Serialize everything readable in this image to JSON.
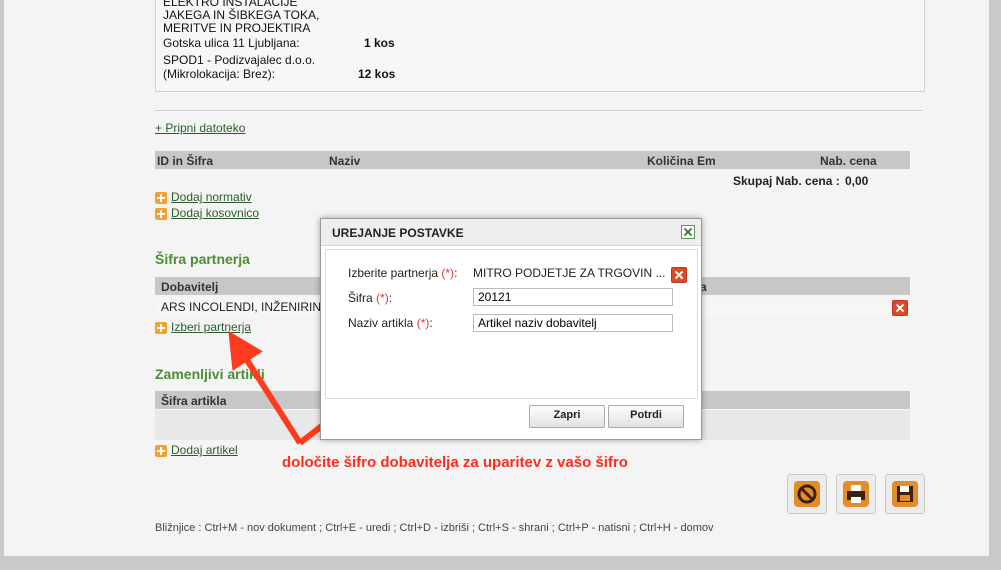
{
  "top_box": {
    "lines": [
      "ELEKTRO INSTALACIJE",
      "JAKEGA IN ŠIBKEGA TOKA,",
      "MERITVE IN PROJEKTIRA",
      "Gotska ulica 11 Ljubljana:",
      "SPOD1 - Podizvajalec d.o.o.",
      "(Mikrolokacija: Brez):"
    ],
    "qty1": "1 kos",
    "qty2": "12 kos"
  },
  "attach_link": "+ Pripni datoteko",
  "items_table": {
    "headers": [
      "ID in Šifra",
      "Naziv",
      "Količina Em",
      "Nab. cena"
    ],
    "total_label": "Skupaj Nab. cena :",
    "total_value": "0,00",
    "add_normative": "Dodaj normativ",
    "add_piece": "Dodaj kosovnico"
  },
  "partner_section": {
    "title": "Šifra partnerja",
    "header_supplier": "Dobavitelj",
    "header_right": "a",
    "row_supplier": "ARS INCOLENDI, INŽENIRING",
    "choose_partner": "Izberi partnerja"
  },
  "replace_section": {
    "title": "Zamenljivi artikli",
    "header": "Šifra artikla",
    "add_article": "Dodaj artikel"
  },
  "dialog": {
    "title": "UREJANJE POSTAVKE",
    "partner_label": "Izberite partnerja",
    "partner_value": "MITRO PODJETJE ZA TRGOVIN ...",
    "code_label": "Šifra",
    "code_value": "20121",
    "name_label": "Naziv artikla",
    "name_value": "Artikel naziv dobavitelj",
    "required_mark": "(*)",
    "colon": ":",
    "btn_close": "Zapri",
    "btn_confirm": "Potrdi"
  },
  "annotation": "določite šifro dobavitelja za uparitev z vašo šifro",
  "shortcuts": "Bližnjice : Ctrl+M - nov dokument ;   Ctrl+E - uredi ;   Ctrl+D - izbriši ;   Ctrl+S - shrani ;   Ctrl+P - natisni ;   Ctrl+H - domov",
  "colors": {
    "accent_green": "#4e8c36",
    "annotation_red": "#ff2a1a",
    "toolbar_orange": "#e58c2a"
  },
  "icons": [
    "plus-icon",
    "delete-icon",
    "close-icon",
    "cancel-icon",
    "print-icon",
    "save-icon"
  ]
}
